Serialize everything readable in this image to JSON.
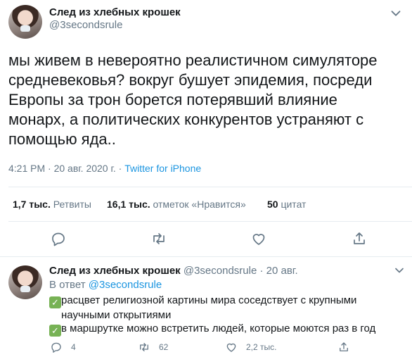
{
  "tweet": {
    "author_name": "След из хлебных крошек",
    "author_handle": "@3secondsrule",
    "text_lines": [
      "мы живем  в невероятно реалистичном симуляторе",
      "средневековья? вокруг бушует эпидемия, посреди",
      "Европы за трон борется потерявший влияние",
      "монарх, а политических конкурентов устраняют с",
      "помощью яда.."
    ],
    "timestamp": "4:21 PM · 20 авг. 2020 г. · ",
    "source": "Twitter for iPhone",
    "stats": {
      "retweets_count": "1,7 тыс.",
      "retweets_label": "Ретвиты",
      "likes_count": "16,1 тыс.",
      "likes_label": "отметок «Нравится»",
      "quotes_count": "50",
      "quotes_label": "цитат"
    }
  },
  "reply": {
    "author_name": "След из хлебных крошек",
    "author_handle": "@3secondsrule · 20 авг.",
    "reply_to_prefix": "В ответ ",
    "reply_to_handle": "@3secondsrule",
    "lines": [
      "расцвет религиозной картины мира соседствует с крупными",
      "научными открытиями",
      "в маршрутке можно встретить людей, которые моются раз в год"
    ],
    "check_glyph": "✓",
    "reply_count": "4",
    "retweet_count": "62",
    "like_count": "2,2 тыс."
  },
  "icons": {
    "reply": "reply-icon",
    "retweet": "retweet-icon",
    "like": "heart-icon",
    "share": "share-icon",
    "more": "chevron-down-icon"
  },
  "colors": {
    "link": "#1b95e0",
    "muted": "#657786",
    "text": "#14171a",
    "check": "#77b255"
  }
}
